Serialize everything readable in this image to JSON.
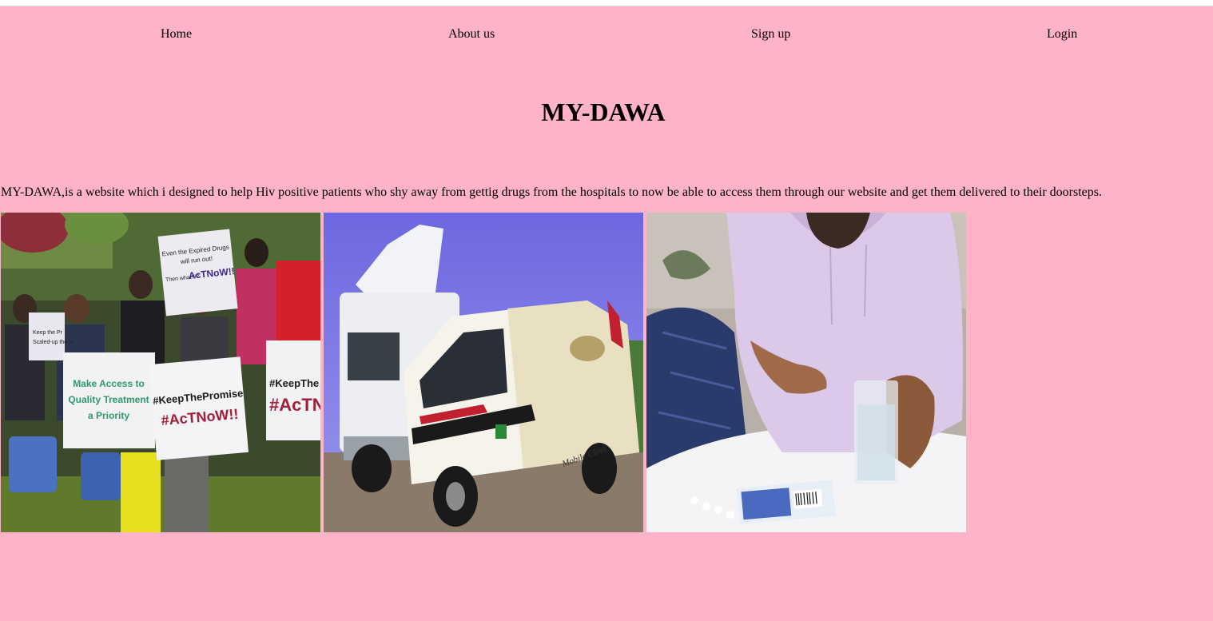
{
  "nav": {
    "home": "Home",
    "about": "About us",
    "signup": "Sign up",
    "login": "Login"
  },
  "header": {
    "title": "MY-DAWA"
  },
  "main": {
    "intro": "MY-DAWA,is a website which i designed to help Hiv positive patients who shy away from gettig drugs from the hospitals to now be able to access them through our website and get them delivered to their doorsteps."
  },
  "photos": {
    "protest": {
      "sign_top_1": "Even the Expired Drugs",
      "sign_top_2": "will run out!",
      "sign_top_3": "Then what?!?",
      "sign_top_4": "AcTNoW!!",
      "sign_left_1": "Keep the Pr",
      "sign_left_2": "Scaled-up the Tr",
      "sign_green_1": "Make Access to",
      "sign_green_2": "Quality Treatment",
      "sign_green_3": "a Priority",
      "sign_mid_1": "#KeepThePromise",
      "sign_mid_2": "#AcTNoW!!",
      "sign_right_1": "#KeepThe",
      "sign_right_2": "#AcTN"
    },
    "van": {
      "text": "Mobile Clinic"
    }
  },
  "colors": {
    "page_bg": "#feb3c8",
    "sky": "#7a70e0",
    "hoodie": "#dcc8e8"
  }
}
